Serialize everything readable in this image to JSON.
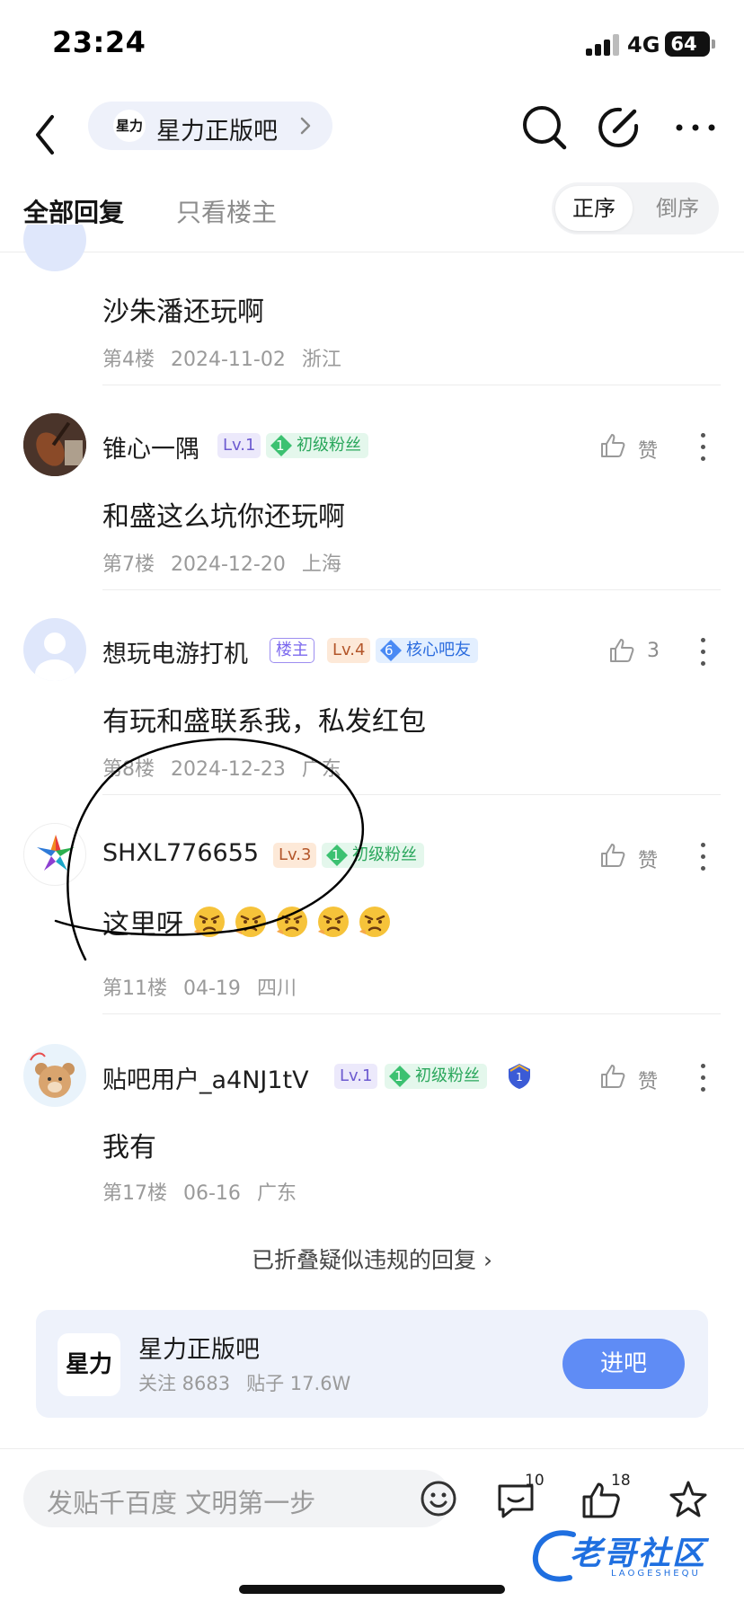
{
  "status_bar": {
    "time": "23:24",
    "network": "4G",
    "battery": "64"
  },
  "nav": {
    "forum_name": "星力正版吧",
    "forum_logo_text": "星力"
  },
  "tabs": {
    "all_replies": "全部回复",
    "only_op": "只看楼主"
  },
  "sort": {
    "ascending": "正序",
    "descending": "倒序"
  },
  "posts": [
    {
      "content": "沙朱潘还玩啊",
      "floor": "第4楼",
      "date": "2024-11-02",
      "location": "浙江"
    },
    {
      "username": "锥心一隅",
      "level": "Lv.1",
      "fan_level": "1",
      "fan_title": "初级粉丝",
      "likes": "赞",
      "content": "和盛这么坑你还玩啊",
      "floor": "第7楼",
      "date": "2024-12-20",
      "location": "上海"
    },
    {
      "username": "想玩电游打机",
      "op_tag": "楼主",
      "level": "Lv.4",
      "fan_level": "6",
      "fan_title": "核心吧友",
      "likes": "3",
      "content": "有玩和盛联系我，私发红包",
      "floor": "第8楼",
      "date": "2024-12-23",
      "location": "广东"
    },
    {
      "username": "SHXL776655",
      "level": "Lv.3",
      "fan_level": "1",
      "fan_title": "初级粉丝",
      "likes": "赞",
      "content": "这里呀",
      "floor": "第11楼",
      "date": "04-19",
      "location": "四川",
      "emoji_count": 5
    },
    {
      "username": "贴吧用户_a4NJ1tV",
      "level": "Lv.1",
      "fan_level": "1",
      "fan_title": "初级粉丝",
      "extra_badge": "1",
      "likes": "赞",
      "content": "我有",
      "floor": "第17楼",
      "date": "06-16",
      "location": "广东"
    }
  ],
  "folded": "已折叠疑似违规的回复 ›",
  "forum_card": {
    "logo_text": "星力",
    "name": "星力正版吧",
    "follows": "关注 8683",
    "posts": "贴子 17.6W",
    "join_label": "进吧"
  },
  "bottom_bar": {
    "placeholder": "发贴千百度 文明第一步",
    "comments_count": "10",
    "likes_count": "18"
  },
  "watermark": {
    "text": "老哥社区",
    "sub": "LAOGESHEQU"
  },
  "colors": {
    "accent": "#5f8cf5",
    "chip_bg": "#eef1fa",
    "card_bg": "#eef2fb",
    "annotation": "#000000"
  }
}
